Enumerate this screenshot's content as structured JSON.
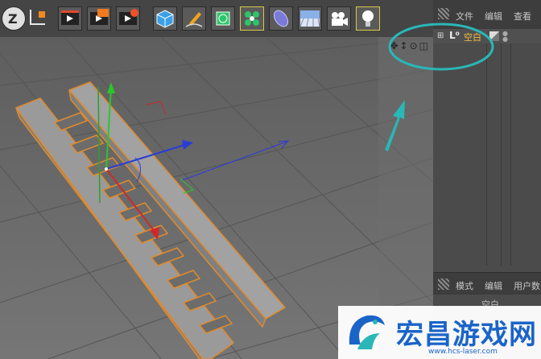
{
  "toolbar": {
    "buttons": [
      {
        "name": "undo-z-icon"
      },
      {
        "name": "coordinate-system-icon"
      },
      {
        "name": "render-view-icon"
      },
      {
        "name": "render-to-picture-viewer-icon"
      },
      {
        "name": "render-settings-icon"
      },
      {
        "name": "cube-icon"
      },
      {
        "name": "pen-spline-icon"
      },
      {
        "name": "subdivision-surface-icon"
      },
      {
        "name": "cloner-icon"
      },
      {
        "name": "deformer-icon"
      },
      {
        "name": "floor-icon"
      },
      {
        "name": "camera-icon"
      },
      {
        "name": "light-icon"
      }
    ]
  },
  "object_manager": {
    "menu": [
      "文件",
      "编辑",
      "查看"
    ],
    "object_name": "空白"
  },
  "attribute_manager": {
    "menu": [
      "模式",
      "编辑",
      "用户数"
    ],
    "object_name": "空白"
  },
  "watermark": {
    "title": "宏昌游戏网",
    "url": "www.hcs-laser.com"
  },
  "colors": {
    "accent_cyan": "#2ab7b7",
    "selection_orange": "#e08a2c",
    "axis_x": "#d02828",
    "axis_y": "#28c828",
    "axis_z": "#2a3cd8",
    "watermark_blue": "#1a64c8"
  }
}
